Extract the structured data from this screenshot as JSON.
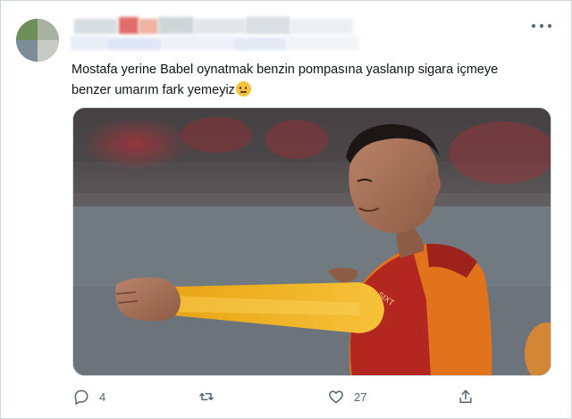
{
  "tweet": {
    "text_line1": "Mostafa yerine Babel oynatmak benzin pompasına yaslanıp sigara içmeye",
    "text_line2": "benzer umarım fark yemeyiz",
    "emoji": "neutral-face-emoji"
  },
  "media": {
    "description_icon": "photo-of-football-player-in-galatasaray-kit",
    "sponsor_text": "SIXT",
    "colors": {
      "sleeve_yellow": "#f2b21c",
      "shirt_red": "#b5261d",
      "shirt_orange": "#e8761f"
    }
  },
  "actions": {
    "reply_count": "4",
    "retweet_count": "",
    "like_count": "27"
  },
  "icons": [
    "more-icon",
    "reply-icon",
    "retweet-icon",
    "like-icon",
    "share-icon"
  ]
}
